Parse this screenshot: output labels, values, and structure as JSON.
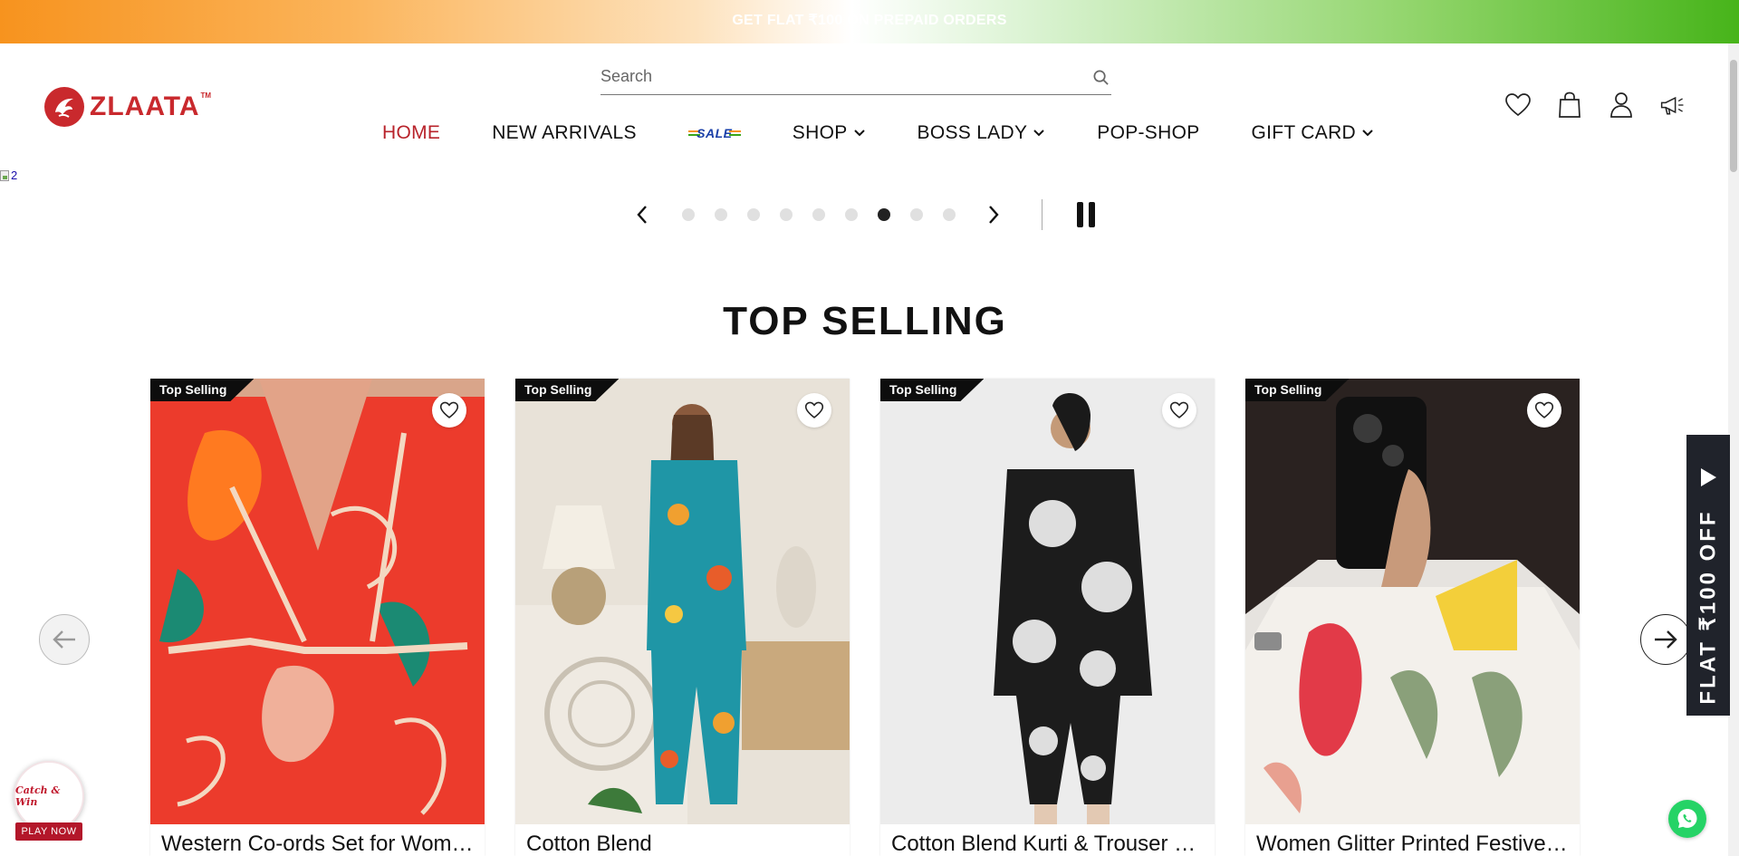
{
  "announcement": {
    "text": "GET FLAT ₹100 ON PREPAID ORDERS"
  },
  "brand": {
    "name": "ZLAATA",
    "tm": "TM",
    "color": "#c9292d"
  },
  "search": {
    "placeholder": "Search",
    "value": ""
  },
  "nav": {
    "items": [
      {
        "label": "HOME",
        "active": true,
        "dropdown": false
      },
      {
        "label": "NEW ARRIVALS",
        "active": false,
        "dropdown": false
      },
      {
        "label": "SHOP",
        "active": false,
        "dropdown": true
      },
      {
        "label": "BOSS LADY",
        "active": false,
        "dropdown": true
      },
      {
        "label": "POP-SHOP",
        "active": false,
        "dropdown": false
      },
      {
        "label": "GIFT CARD",
        "active": false,
        "dropdown": true
      }
    ],
    "sale_badge": "SALE",
    "active_color": "#b8232b"
  },
  "header_icons": [
    "heart-icon",
    "bag-icon",
    "user-icon",
    "megaphone-icon"
  ],
  "banner": {
    "alt": "2"
  },
  "slider": {
    "total_slides": 9,
    "active_index": 6
  },
  "section": {
    "title": "TOP SELLING"
  },
  "products": [
    {
      "tag": "Top Selling",
      "title": "Western Co-ords Set for Women"
    },
    {
      "tag": "Top Selling",
      "title": "Cotton Blend"
    },
    {
      "tag": "Top Selling",
      "title": "Cotton Blend Kurti & Trouser Set"
    },
    {
      "tag": "Top Selling",
      "title": "Women Glitter Printed Festive Top"
    }
  ],
  "side_offer": {
    "text": "FLAT ₹100 OFF"
  },
  "catch_win": {
    "title": "Catch & Win",
    "cta": "PLAY NOW"
  }
}
